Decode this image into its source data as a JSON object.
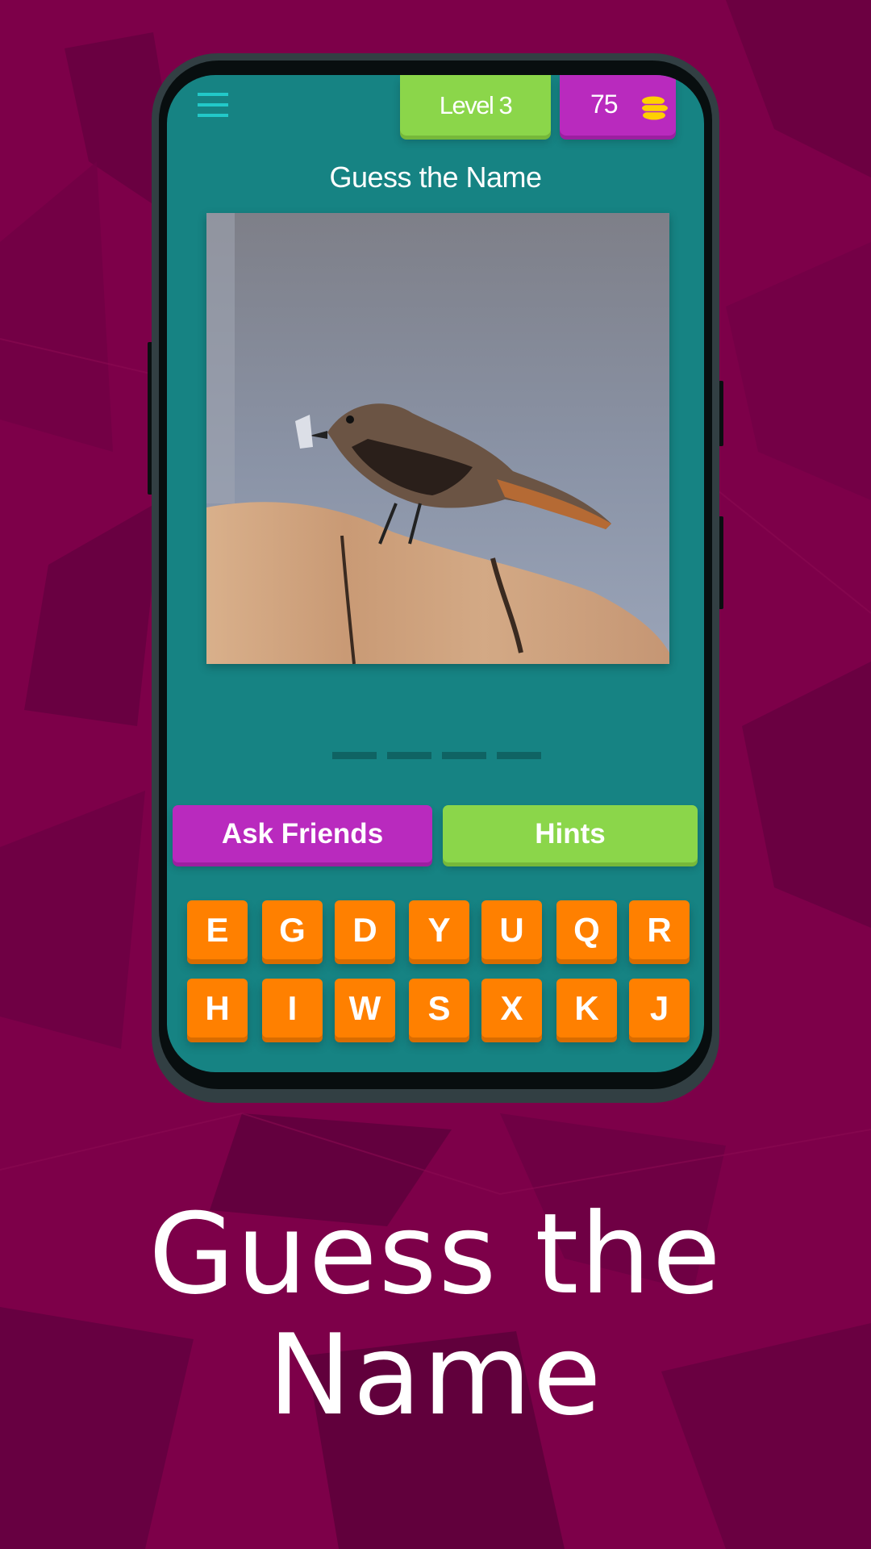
{
  "app": {
    "header": {
      "menu_icon": "hamburger-menu-icon",
      "level_label": "Level 3",
      "coins": "75",
      "coin_icon": "coin-stack-icon"
    },
    "title": "Guess the Name",
    "puzzle_image": {
      "alt": "bird perched on a wooden post holding an insect"
    },
    "answer": {
      "slots": [
        "",
        "",
        "",
        ""
      ]
    },
    "buttons": {
      "ask_friends": "Ask Friends",
      "hints": "Hints"
    },
    "letters": {
      "row1": [
        "E",
        "G",
        "D",
        "Y",
        "U",
        "Q",
        "R"
      ],
      "row2": [
        "H",
        "I",
        "W",
        "S",
        "X",
        "K",
        "J"
      ]
    }
  },
  "promo": {
    "title": "Guess the Name"
  },
  "colors": {
    "background": "#7d0049",
    "screen": "#168383",
    "level_badge": "#8bd64a",
    "coins_badge": "#b92abe",
    "tile": "#ff8000",
    "accent_menu": "#22c9c9",
    "coin": "#ffd000"
  }
}
